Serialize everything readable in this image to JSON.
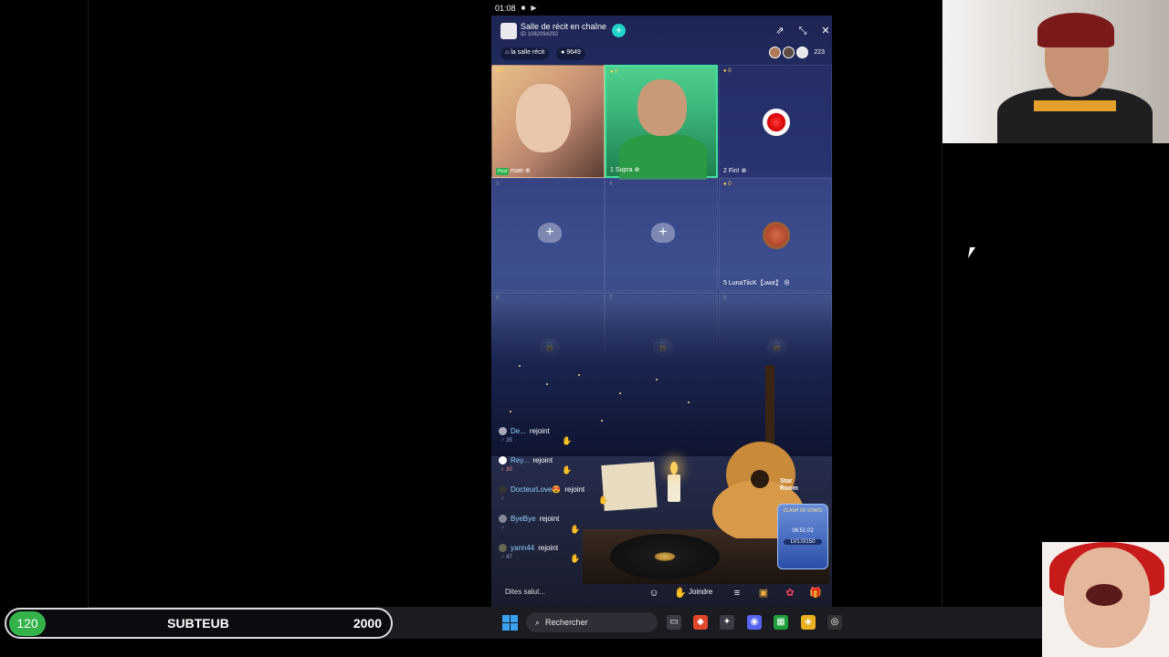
{
  "status_bar": {
    "time": "01:08"
  },
  "room": {
    "title": "Salle de récit en chaîne",
    "id_text": "ID 1082094292",
    "tag_home": "la salle récit",
    "coins": "9649",
    "viewer_count": "223"
  },
  "seats": [
    {
      "num": "0",
      "badge": "Host",
      "name": "mae"
    },
    {
      "num": "0",
      "index": "1",
      "name": "Supra"
    },
    {
      "num": "0",
      "index": "2",
      "name": "Fin!"
    },
    {
      "index": "3"
    },
    {
      "index": "4"
    },
    {
      "num": "0",
      "index": "5",
      "name": "LunaTiicK【ᴊᴀᴋᴇ】"
    },
    {
      "index": "6"
    },
    {
      "index": "7"
    },
    {
      "index": "8"
    }
  ],
  "chat": [
    {
      "name": "De...",
      "action": "rejoint",
      "sub": "35"
    },
    {
      "name": "Rey...",
      "action": "rejoint",
      "sub": "30"
    },
    {
      "name": "DocteurLove😍",
      "action": "rejoint",
      "sub": ""
    },
    {
      "name": "ByeBye",
      "action": "rejoint",
      "sub": ""
    },
    {
      "name": "yann44",
      "action": "rejoint",
      "sub": "47"
    }
  ],
  "star_room": {
    "line1": "Star",
    "line2": "Room"
  },
  "event_card": {
    "title": "CLASH OF STARS",
    "timer": "06:51:02",
    "level": "LV1:0/150"
  },
  "bottom_bar": {
    "say_hi": "Dites salut...",
    "join": "Joindre"
  },
  "sub_goal": {
    "count": "120",
    "label": "SUBTEUB",
    "goal": "2000"
  },
  "taskbar": {
    "search_placeholder": "Rechercher"
  },
  "colors": {
    "accent_teal": "#21d4c8",
    "goal_green": "#35b34b",
    "taskbar_bg": "#1b1c22"
  }
}
